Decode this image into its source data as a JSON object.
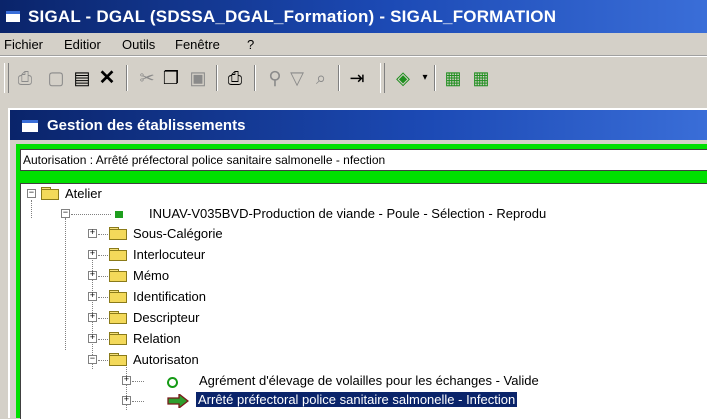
{
  "window": {
    "title": "SIGAL - DGAL (SDSSA_DGAL_Formation) - SIGAL_FORMATION"
  },
  "menu": [
    "Fichier",
    "Editior",
    "Outils",
    "Fenêtre",
    "?"
  ],
  "toolbar_icons": [
    "print-preview-icon",
    "new-document-icon",
    "properties-icon",
    "delete-icon",
    "cut-icon",
    "copy-icon",
    "paste-icon",
    "print-icon",
    "find-icon",
    "filter-icon",
    "zoom-icon",
    "exit-icon",
    "green-stack-icon",
    "green-blocks-icon"
  ],
  "child_window": {
    "title": "Gestion des établissements"
  },
  "autorisation_field": "Autorisation : Arrêté préfectoral police sanitaire salmonelle - nfection",
  "tree": {
    "root": "Atelier",
    "production": "INUAV-V035BVD-Production de viande - Poule - Sélection - Reprodu",
    "folders": [
      "Sous-Calégorie",
      "Interlocuteur",
      "Mémo",
      "Identification",
      "Descripteur",
      "Relation",
      "Autorisaton"
    ],
    "autorisations": [
      "Agrément d'élevage de volailles pour les échanges - Valide",
      "Arrêté préfectoral police sanitaire salmonelle - Infection"
    ]
  },
  "colors": {
    "title_bar": "#0a246a",
    "highlight_frame": "#00e000",
    "selection": "#0a246a"
  }
}
